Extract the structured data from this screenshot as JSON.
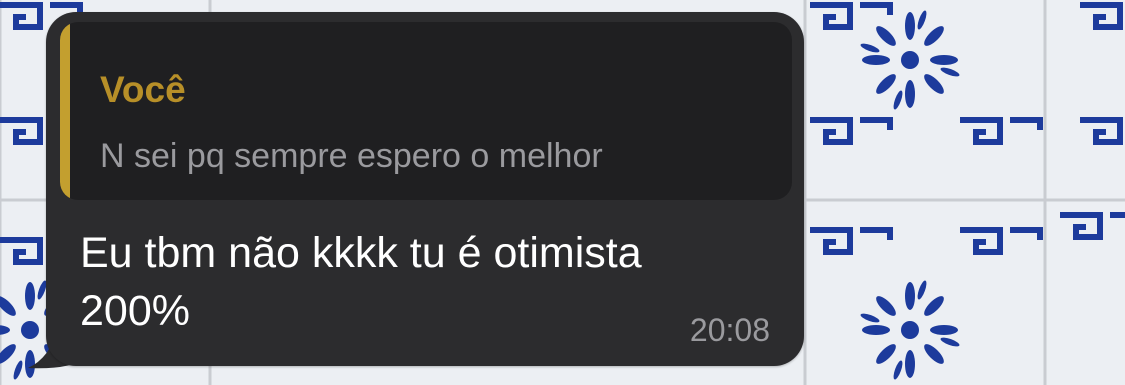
{
  "wallpaper": {
    "pattern": "blue-white-azulejo-tiles",
    "tile_color": "#1d3b9c",
    "background_color": "#eceff3"
  },
  "message": {
    "reply_quote": {
      "author": "Você",
      "text": "N sei pq sempre espero o melhor",
      "accent_color": "#c39f2f"
    },
    "text": "Eu tbm não kkkk tu é otimista 200%",
    "time": "20:08",
    "bubble_color": "#2c2c2e"
  }
}
